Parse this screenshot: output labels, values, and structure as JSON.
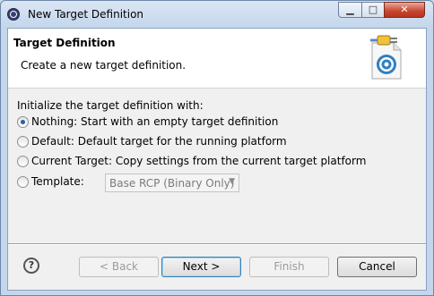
{
  "window": {
    "title": "New Target Definition",
    "controls": {
      "minimize": "▁",
      "maximize": "□",
      "close": "✕"
    }
  },
  "banner": {
    "title": "Target Definition",
    "message": "Create a new target definition.",
    "image_icon": "target-plugin-icon"
  },
  "form": {
    "group_label": "Initialize the target definition with:",
    "options": [
      {
        "label": "Nothing: Start with an empty target definition",
        "checked": true
      },
      {
        "label": "Default: Default target for the running platform",
        "checked": false
      },
      {
        "label": "Current Target: Copy settings from the current target platform",
        "checked": false
      },
      {
        "label": "Template:",
        "checked": false
      }
    ],
    "template_combo": {
      "value": "Base RCP (Binary Only)",
      "enabled": false
    }
  },
  "buttons": {
    "help": "?",
    "back": "< Back",
    "next": "Next >",
    "finish": "Finish",
    "cancel": "Cancel"
  },
  "colors": {
    "accent": "#2a5fa8",
    "close_button": "#c7442e",
    "frame": "#c4d6ec"
  }
}
